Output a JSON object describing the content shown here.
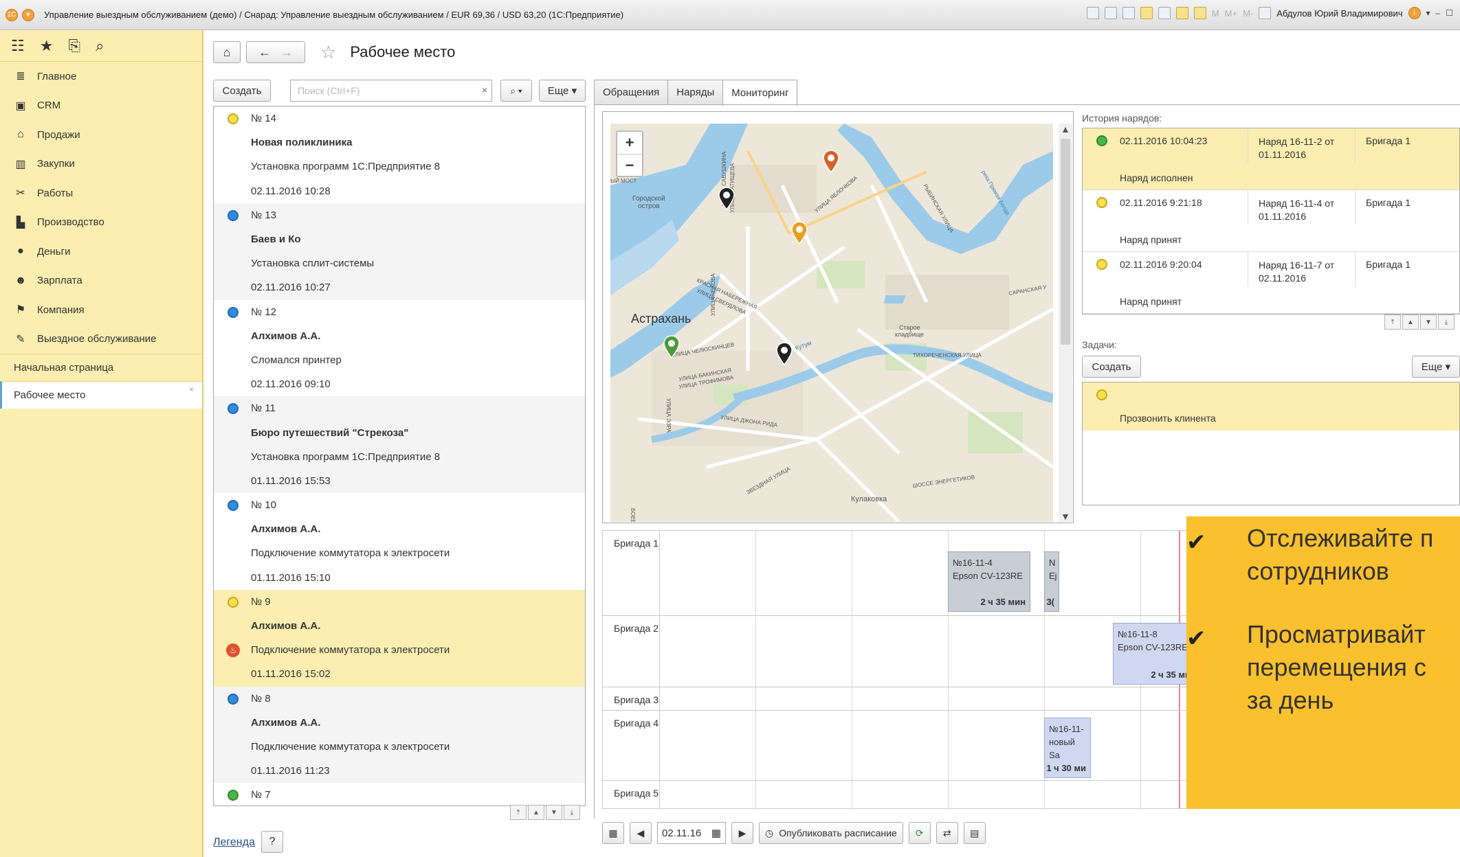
{
  "window": {
    "title": "Управление выездным обслуживанием (демо) / Снарад: Управление выездным обслуживанием / EUR 69,36 / USD 63,20  (1С:Предприятие)",
    "user": "Абдулов Юрий Владимирович",
    "memory_buttons": [
      "M",
      "M+",
      "M-"
    ]
  },
  "sidebar": {
    "top_icons": [
      "apps-grid-icon",
      "star-icon",
      "history-icon",
      "search-icon"
    ],
    "items": [
      {
        "label": "Главное",
        "icon": "list-icon"
      },
      {
        "label": "CRM",
        "icon": "crm-icon"
      },
      {
        "label": "Продажи",
        "icon": "basket-icon"
      },
      {
        "label": "Закупки",
        "icon": "purchases-icon"
      },
      {
        "label": "Работы",
        "icon": "tools-icon"
      },
      {
        "label": "Производство",
        "icon": "factory-icon"
      },
      {
        "label": "Деньги",
        "icon": "money-icon"
      },
      {
        "label": "Зарплата",
        "icon": "people-icon"
      },
      {
        "label": "Компания",
        "icon": "flag-icon"
      },
      {
        "label": "Выездное обслуживание",
        "icon": "wrench-icon"
      }
    ],
    "sub": {
      "home": "Начальная страница",
      "workplace": "Рабочее место",
      "close": "×"
    }
  },
  "page": {
    "title": "Рабочее место"
  },
  "list_toolbar": {
    "create": "Создать",
    "search_placeholder": "Поиск (Ctrl+F)",
    "more": "Еще",
    "clear": "×"
  },
  "list": [
    {
      "text": "№ 14",
      "marker": "yellow",
      "bold": false,
      "alt": false,
      "sel": false
    },
    {
      "text": "Новая поликлиника",
      "marker": "",
      "bold": true,
      "alt": false,
      "sel": false
    },
    {
      "text": "Установка программ 1С:Предприятие 8",
      "marker": "",
      "bold": false,
      "alt": false,
      "sel": false
    },
    {
      "text": "02.11.2016 10:28",
      "marker": "",
      "bold": false,
      "alt": false,
      "sel": false
    },
    {
      "text": "№ 13",
      "marker": "blue",
      "bold": false,
      "alt": true,
      "sel": false
    },
    {
      "text": "Баев и Ко",
      "marker": "",
      "bold": true,
      "alt": true,
      "sel": false
    },
    {
      "text": "Установка сплит-системы",
      "marker": "",
      "bold": false,
      "alt": true,
      "sel": false
    },
    {
      "text": "02.11.2016 10:27",
      "marker": "",
      "bold": false,
      "alt": true,
      "sel": false
    },
    {
      "text": "№ 12",
      "marker": "blue",
      "bold": false,
      "alt": false,
      "sel": false
    },
    {
      "text": "Алхимов А.А.",
      "marker": "",
      "bold": true,
      "alt": false,
      "sel": false
    },
    {
      "text": "Сломался принтер",
      "marker": "",
      "bold": false,
      "alt": false,
      "sel": false
    },
    {
      "text": "02.11.2016 09:10",
      "marker": "",
      "bold": false,
      "alt": false,
      "sel": false
    },
    {
      "text": "№ 11",
      "marker": "blue",
      "bold": false,
      "alt": true,
      "sel": false
    },
    {
      "text": "Бюро путешествий \"Стрекоза\"",
      "marker": "",
      "bold": true,
      "alt": true,
      "sel": false
    },
    {
      "text": "Установка программ 1С:Предприятие 8",
      "marker": "",
      "bold": false,
      "alt": true,
      "sel": false
    },
    {
      "text": "01.11.2016 15:53",
      "marker": "",
      "bold": false,
      "alt": true,
      "sel": false
    },
    {
      "text": "№ 10",
      "marker": "blue",
      "bold": false,
      "alt": false,
      "sel": false
    },
    {
      "text": "Алхимов А.А.",
      "marker": "",
      "bold": true,
      "alt": false,
      "sel": false
    },
    {
      "text": "Подключение коммутатора к электросети",
      "marker": "",
      "bold": false,
      "alt": false,
      "sel": false
    },
    {
      "text": "01.11.2016 15:10",
      "marker": "",
      "bold": false,
      "alt": false,
      "sel": false
    },
    {
      "text": "№ 9",
      "marker": "yellow",
      "bold": false,
      "alt": false,
      "sel": true
    },
    {
      "text": "Алхимов А.А.",
      "marker": "",
      "bold": true,
      "alt": false,
      "sel": true
    },
    {
      "text": "Подключение коммутатора к электросети",
      "marker": "fire",
      "bold": false,
      "alt": false,
      "sel": true
    },
    {
      "text": "01.11.2016 15:02",
      "marker": "",
      "bold": false,
      "alt": false,
      "sel": true
    },
    {
      "text": "№ 8",
      "marker": "blue",
      "bold": false,
      "alt": true,
      "sel": false
    },
    {
      "text": "Алхимов А.А.",
      "marker": "",
      "bold": true,
      "alt": true,
      "sel": false
    },
    {
      "text": "Подключение коммутатора к электросети",
      "marker": "",
      "bold": false,
      "alt": true,
      "sel": false
    },
    {
      "text": "01.11.2016 11:23",
      "marker": "",
      "bold": false,
      "alt": true,
      "sel": false
    },
    {
      "text": "№ 7",
      "marker": "green",
      "bold": false,
      "alt": false,
      "sel": false
    }
  ],
  "legend": {
    "link": "Легенда",
    "help": "?"
  },
  "tabs": [
    {
      "label": "Обращения",
      "active": false
    },
    {
      "label": "Наряды",
      "active": false
    },
    {
      "label": "Мониторинг",
      "active": true
    }
  ],
  "map": {
    "zoom_in": "+",
    "zoom_out": "−",
    "labels": {
      "city": "Астрахань",
      "island": "Городской\nостров",
      "cemetery": "Старое\nкладбище",
      "kulakovka": "Кулаковка",
      "kutum": "Кутум",
      "street1": "УЛИЦА САВУШКИНА",
      "street2": "УЛИЦА ТАТИЩЕВА",
      "street3": "УЛИЦА ЯБЛОЧКОВА",
      "street4": "КРАСНАЯ НАБЕРЕЖНАЯ",
      "street5": "УЛИЦА СВЕРДЛОВА",
      "street6": "УЛИЦА ЧЕЛЮСКИНЦЕВ",
      "street7": "УЛИЦА БАКИНСКАЯ",
      "street8": "УЛИЦА ТРОФИМОВА",
      "street9": "УЛИЦА ДЖОНА РИДА",
      "street10": "ЗВЕЗДНАЯ УЛИЦА",
      "street11": "ТИХОРЕЧЕНСКАЯ УЛИЦА",
      "street12": "ШОССЕ ЭНЕРГЕТИКОВ",
      "street13": "САРАНСКАЯ У",
      "street14": "РЫБИНСКАЯ УЛИЦА",
      "street15": "УЛИЦА ЧЕХОВА",
      "street16": "БОЕВАЯ УЛИЦА",
      "street17": "УЛИЦА ЭЗРА",
      "street18": "река Прямая Болда",
      "street19": "ЫЙ МОСТ"
    },
    "markers": [
      {
        "color": "#d4622b"
      },
      {
        "color": "#222222"
      },
      {
        "color": "#e5a21f"
      },
      {
        "color": "#4a9a3a"
      },
      {
        "color": "#222222"
      }
    ]
  },
  "history": {
    "label": "История нарядов:",
    "rows": [
      {
        "date": "02.11.2016 10:04:23",
        "order": "Наряд 16-11-2 от 01.11.2016",
        "brigade": "Бригада 1",
        "status": "Наряд исполнен",
        "dot": "green",
        "sel": true
      },
      {
        "date": "02.11.2016 9:21:18",
        "order": "Наряд 16-11-4 от 01.11.2016",
        "brigade": "Бригада 1",
        "status": "Наряд принят",
        "dot": "yellow",
        "sel": false
      },
      {
        "date": "02.11.2016 9:20:04",
        "order": "Наряд 16-11-7 от 02.11.2016",
        "brigade": "Бригада 1",
        "status": "Наряд принят",
        "dot": "yellow",
        "sel": false
      }
    ]
  },
  "tasks": {
    "label": "Задачи:",
    "create": "Создать",
    "more": "Еще",
    "rows": [
      {
        "text": "Прозвонить клинента"
      }
    ]
  },
  "gantt": {
    "rows": [
      {
        "label": "Бригада 1"
      },
      {
        "label": "Бригада 2"
      },
      {
        "label": "Бригада 3"
      },
      {
        "label": "Бригада 4"
      },
      {
        "label": "Бригада 5"
      }
    ],
    "bars": [
      {
        "line1": "№16-11-4",
        "line2": "Epson CV-123RE",
        "dur": "2 ч 35 мин"
      },
      {
        "line1": "N",
        "line2": "Ej",
        "dur": "3("
      },
      {
        "line1": "№16-11-8",
        "line2": "Epson CV-123RE",
        "dur": "2 ч 35 ми"
      },
      {
        "line1": "№16-11-",
        "line2": "новый Sa",
        "dur": "1 ч 30 ми"
      }
    ]
  },
  "bottom": {
    "date": "02.11.16",
    "publish": "Опубликовать расписание"
  },
  "promo": {
    "items": [
      {
        "text": "Отслеживайте п\nсотрудников"
      },
      {
        "text": "Просматривайт\nперемещения с\nза день"
      }
    ]
  }
}
